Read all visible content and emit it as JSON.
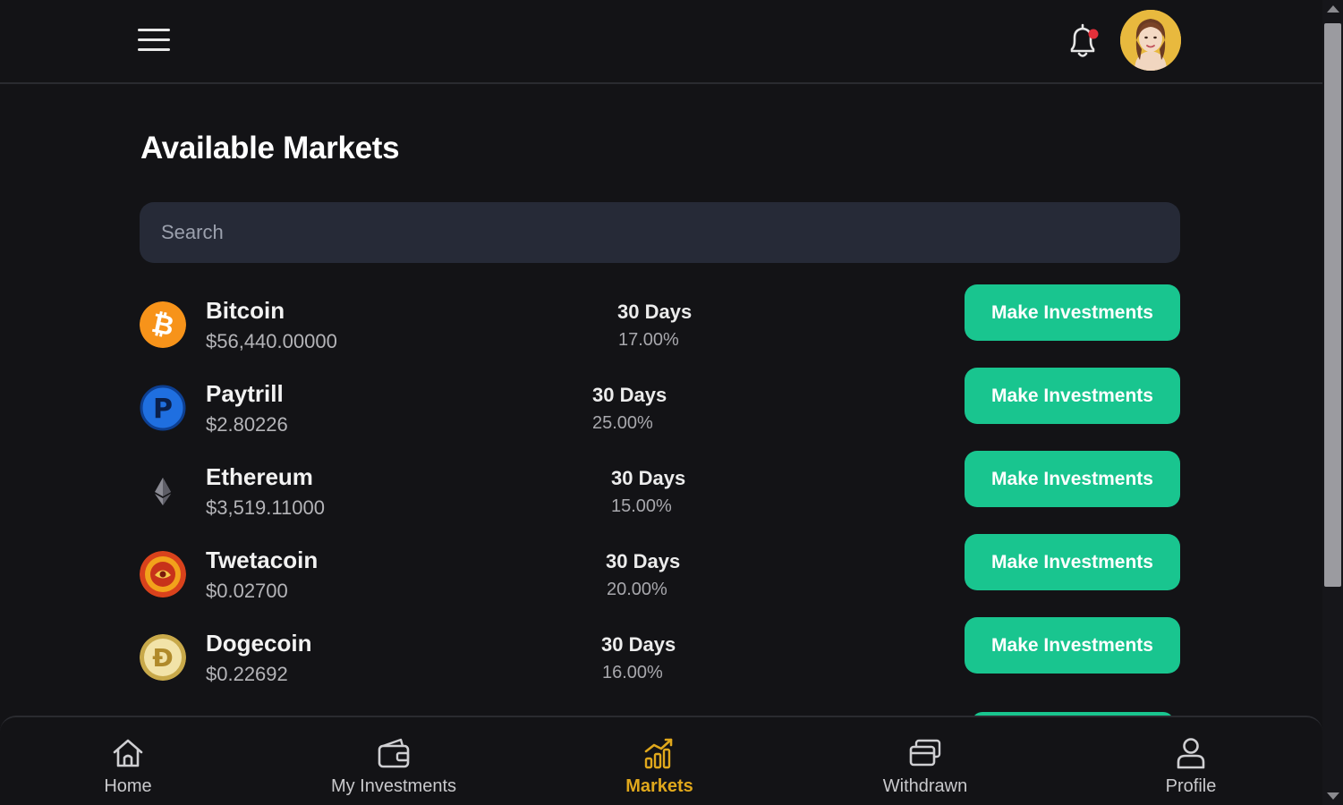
{
  "header": {
    "menu_icon": "hamburger-menu-icon",
    "notification_icon": "bell-icon",
    "notification_dot_color": "#e5303a",
    "avatar": "user-avatar"
  },
  "main": {
    "title": "Available Markets",
    "search": {
      "placeholder": "Search",
      "value": ""
    },
    "markets": [
      {
        "name": "Bitcoin",
        "price": "$56,440.00000",
        "duration": "30 Days",
        "rate": "17.00%",
        "button_label": "Make Investments",
        "icon": "bitcoin-icon"
      },
      {
        "name": "Paytrill",
        "price": "$2.80226",
        "duration": "30 Days",
        "rate": "25.00%",
        "button_label": "Make Investments",
        "icon": "paytrill-icon"
      },
      {
        "name": "Ethereum",
        "price": "$3,519.11000",
        "duration": "30 Days",
        "rate": "15.00%",
        "button_label": "Make Investments",
        "icon": "ethereum-icon"
      },
      {
        "name": "Twetacoin",
        "price": "$0.02700",
        "duration": "30 Days",
        "rate": "20.00%",
        "button_label": "Make Investments",
        "icon": "twetacoin-icon"
      },
      {
        "name": "Dogecoin",
        "price": "$0.22692",
        "duration": "30 Days",
        "rate": "16.00%",
        "button_label": "Make Investments",
        "icon": "dogecoin-icon"
      }
    ]
  },
  "bottom_nav": {
    "items": [
      {
        "label": "Home",
        "icon": "home-icon",
        "active": false
      },
      {
        "label": "My Investments",
        "icon": "wallet-icon",
        "active": false
      },
      {
        "label": "Markets",
        "icon": "markets-chart-icon",
        "active": true
      },
      {
        "label": "Withdrawn",
        "icon": "cards-icon",
        "active": false
      },
      {
        "label": "Profile",
        "icon": "user-icon",
        "active": false
      }
    ]
  },
  "colors": {
    "background": "#131316",
    "accent_green": "#19c58f",
    "active_nav": "#e0a81c",
    "search_bg": "#262a37"
  }
}
